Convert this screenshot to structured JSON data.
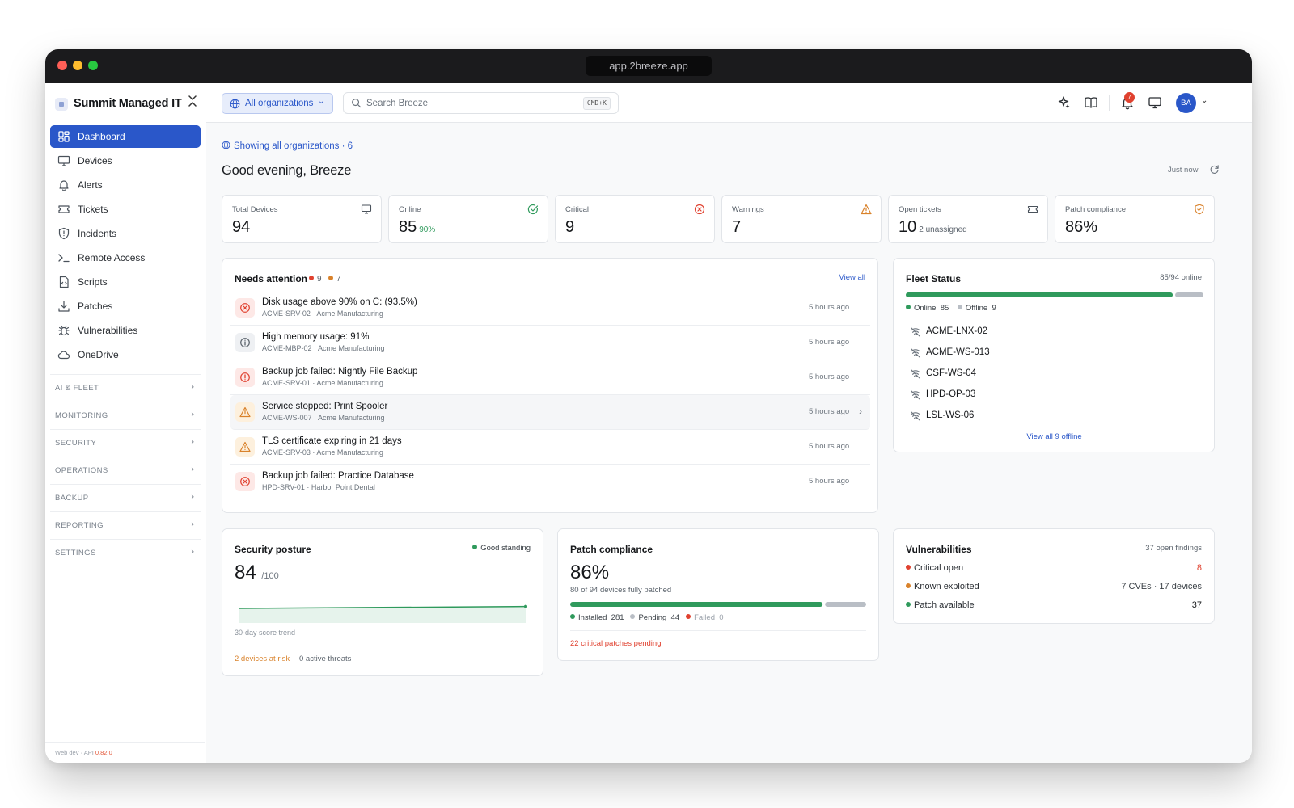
{
  "window": {
    "url": "app.2breeze.app"
  },
  "sidebar": {
    "brand": "Summit Managed IT",
    "items": [
      {
        "label": "Dashboard",
        "icon": "grid-icon",
        "active": true
      },
      {
        "label": "Devices",
        "icon": "monitor-icon"
      },
      {
        "label": "Alerts",
        "icon": "bell-icon"
      },
      {
        "label": "Tickets",
        "icon": "ticket-icon"
      },
      {
        "label": "Incidents",
        "icon": "shield-icon"
      },
      {
        "label": "Remote Access",
        "icon": "terminal-icon"
      },
      {
        "label": "Scripts",
        "icon": "file-code-icon"
      },
      {
        "label": "Patches",
        "icon": "download-icon"
      },
      {
        "label": "Vulnerabilities",
        "icon": "bug-icon"
      },
      {
        "label": "OneDrive",
        "icon": "cloud-icon"
      }
    ],
    "sections": [
      "AI & FLEET",
      "MONITORING",
      "SECURITY",
      "OPERATIONS",
      "BACKUP",
      "REPORTING",
      "SETTINGS"
    ],
    "footer": {
      "env": "Web dev · API ",
      "version": "0.82.0"
    }
  },
  "topbar": {
    "org_select": "All organizations",
    "search_placeholder": "Search Breeze",
    "search_shortcut": "CMD+K",
    "notification_count": "7",
    "avatar_initials": "BA"
  },
  "header": {
    "showing": "Showing all organizations · 6",
    "greeting": "Good evening, Breeze",
    "refreshed": "Just now"
  },
  "stats": [
    {
      "label": "Total Devices",
      "value": "94",
      "sub": "",
      "icon": "monitor-icon"
    },
    {
      "label": "Online",
      "value": "85",
      "sub": "90%",
      "icon": "check-circle-icon"
    },
    {
      "label": "Critical",
      "value": "9",
      "sub": "",
      "icon": "x-circle-icon"
    },
    {
      "label": "Warnings",
      "value": "7",
      "sub": "",
      "icon": "warning-triangle-icon"
    },
    {
      "label": "Open tickets",
      "value": "10",
      "sub": "2 unassigned",
      "icon": "ticket-icon"
    },
    {
      "label": "Patch compliance",
      "value": "86%",
      "sub": "",
      "icon": "shield-check-icon"
    }
  ],
  "needs_attention": {
    "title": "Needs attention",
    "critical_count": "9",
    "warning_count": "7",
    "view_all": "View all",
    "alerts": [
      {
        "title": "Disk usage above 90% on C: (93.5%)",
        "sub": "ACME-SRV-02 · Acme Manufacturing",
        "time": "5 hours ago",
        "severity": "critical"
      },
      {
        "title": "High memory usage: 91%",
        "sub": "ACME-MBP-02 · Acme Manufacturing",
        "time": "5 hours ago",
        "severity": "info"
      },
      {
        "title": "Backup job failed: Nightly File Backup",
        "sub": "ACME-SRV-01 · Acme Manufacturing",
        "time": "5 hours ago",
        "severity": "error"
      },
      {
        "title": "Service stopped: Print Spooler",
        "sub": "ACME-WS-007 · Acme Manufacturing",
        "time": "5 hours ago",
        "severity": "warning"
      },
      {
        "title": "TLS certificate expiring in 21 days",
        "sub": "ACME-SRV-03 · Acme Manufacturing",
        "time": "5 hours ago",
        "severity": "warning"
      },
      {
        "title": "Backup job failed: Practice Database",
        "sub": "HPD-SRV-01 · Harbor Point Dental",
        "time": "5 hours ago",
        "severity": "critical"
      }
    ]
  },
  "fleet_status": {
    "title": "Fleet Status",
    "summary": "85/94 online",
    "online": 85,
    "offline": 9,
    "online_label": "Online",
    "offline_label": "Offline",
    "offline_devices": [
      "ACME-LNX-02",
      "ACME-WS-013",
      "CSF-WS-04",
      "HPD-OP-03",
      "LSL-WS-06"
    ],
    "view_all": "View all 9 offline"
  },
  "security_posture": {
    "title": "Security posture",
    "status": "Good standing",
    "score": "84",
    "max": "/100",
    "trend_label": "30-day score trend",
    "trend": [
      80,
      81,
      82,
      83,
      84
    ],
    "at_risk": "2 devices at risk",
    "threats": "0 active threats"
  },
  "patch_compliance": {
    "title": "Patch compliance",
    "percent": "86%",
    "detail": "80 of 94 devices fully patched",
    "installed_label": "Installed",
    "installed": "281",
    "pending_label": "Pending",
    "pending": "44",
    "failed_label": "Failed",
    "failed": "0",
    "installed_fraction": 0.86,
    "critical_pending": "22 critical patches pending"
  },
  "vulnerabilities": {
    "title": "Vulnerabilities",
    "summary": "37 open findings",
    "rows": [
      {
        "label": "Critical open",
        "value": "8",
        "color": "#e0412f"
      },
      {
        "label": "Known exploited",
        "value": "7 CVEs · 17 devices",
        "color": "#d9822b"
      },
      {
        "label": "Patch available",
        "value": "37",
        "color": "#2f9a5c"
      }
    ]
  },
  "colors": {
    "accent": "#2a57c9",
    "online": "#2f9a5c",
    "offline": "#b9bec5",
    "critical": "#e0412f",
    "warning": "#d9822b"
  }
}
